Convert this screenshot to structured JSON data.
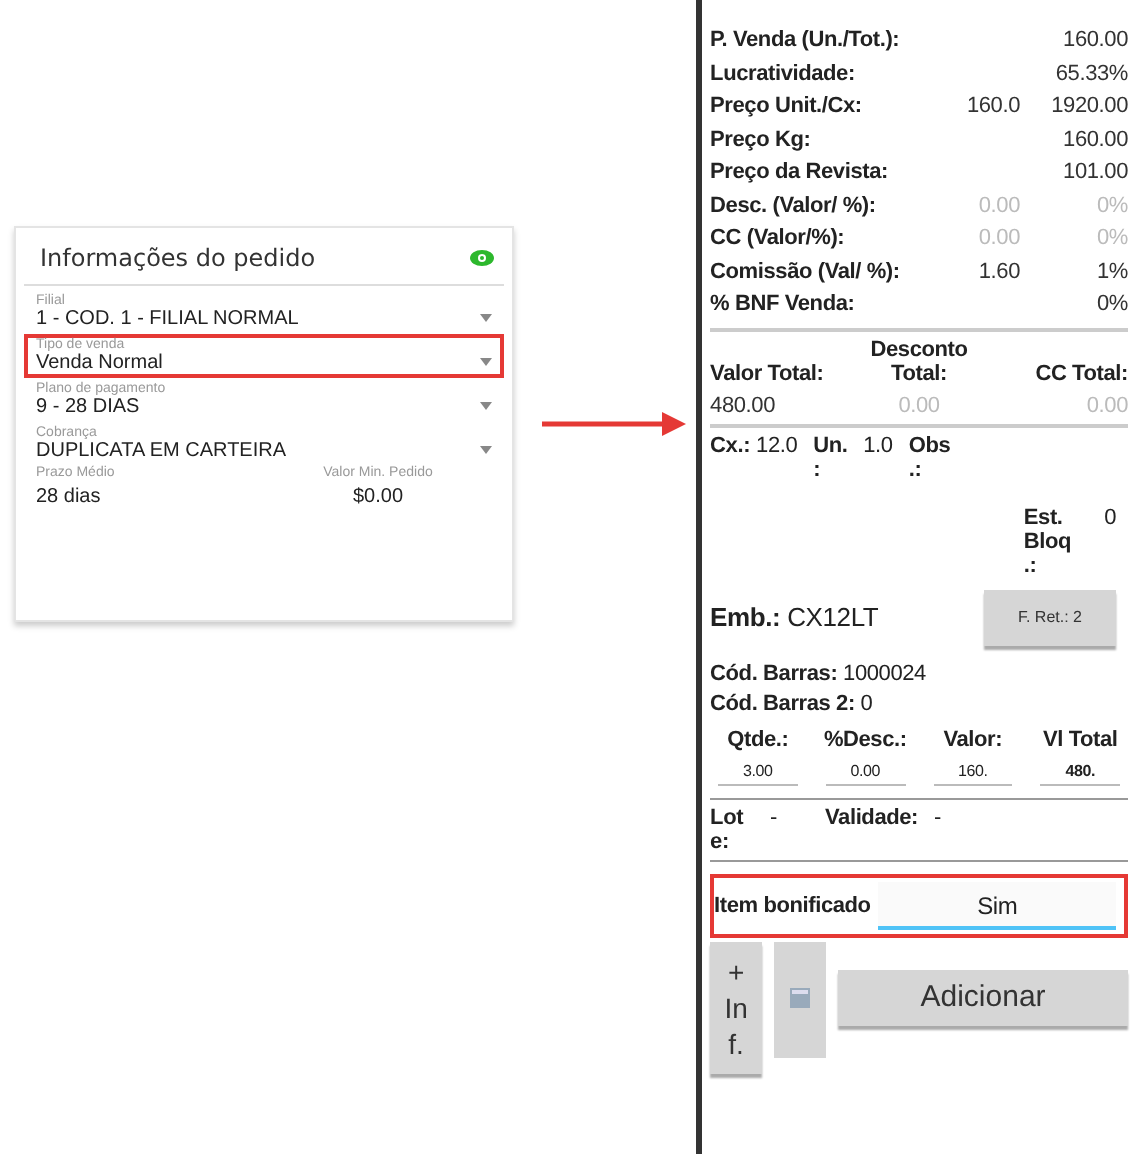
{
  "order_card": {
    "title": "Informações do pedido",
    "fields": [
      {
        "label": "Filial",
        "value": "1 - COD. 1 - FILIAL NORMAL",
        "highlighted": false
      },
      {
        "label": "Tipo de venda",
        "value": "Venda Normal",
        "highlighted": true
      },
      {
        "label": "Plano de pagamento",
        "value": "9 - 28 DIAS",
        "highlighted": false
      },
      {
        "label": "Cobrança",
        "value": "DUPLICATA EM CARTEIRA",
        "highlighted": false
      }
    ],
    "summary": [
      {
        "label": "Prazo Médio",
        "value": "28 dias"
      },
      {
        "label": "Valor Min. Pedido",
        "value": "$0.00"
      }
    ]
  },
  "item_panel": {
    "price_rows": [
      {
        "label": "P. Venda (Un./Tot.):",
        "value_1": "",
        "value_2": "160.00",
        "disabled": false
      },
      {
        "label": "Lucratividade:",
        "value_1": "",
        "value_2": "65.33%",
        "disabled": false
      },
      {
        "label": "Preço Unit./Cx:",
        "value_1": "160.0",
        "value_2": "1920.00",
        "disabled": false
      },
      {
        "label": "Preço Kg:",
        "value_1": "",
        "value_2": "160.00",
        "disabled": false
      },
      {
        "label": "Preço da Revista:",
        "value_1": "",
        "value_2": "101.00",
        "disabled": false
      },
      {
        "label": "Desc. (Valor/ %):",
        "value_1": "0.00",
        "value_2": "0%",
        "disabled": true
      },
      {
        "label": "CC (Valor/%):",
        "value_1": "0.00",
        "value_2": "0%",
        "disabled": true
      },
      {
        "label": "Comissão (Val/ %):",
        "value_1": "1.60",
        "value_2": "1%",
        "disabled": false
      },
      {
        "label": "% BNF Venda:",
        "value_1": "",
        "value_2": "0%",
        "disabled": false
      }
    ],
    "totals": [
      {
        "label": "Valor Total:",
        "value": "480.00",
        "disabled": false
      },
      {
        "label": "Desconto Total:",
        "value": "0.00",
        "disabled": true
      },
      {
        "label": "CC Total:",
        "value": "0.00",
        "disabled": true
      }
    ],
    "units": [
      {
        "label": "Cx.:",
        "value": "12.0"
      },
      {
        "label": "Un. :",
        "value": "1.0"
      },
      {
        "label": "Obs .:"
      }
    ],
    "blocked_stock": {
      "label": "Est. Bloq .:",
      "value": "0"
    },
    "packaging": {
      "label": "Emb.:",
      "value": "CX12LT"
    },
    "return_button": "F. Ret.: 2",
    "barcodes": [
      {
        "label": "Cód. Barras:",
        "value": "1000024"
      },
      {
        "label": "Cód. Barras 2:",
        "value": "0"
      }
    ],
    "quantity_columns": [
      {
        "label": "Qtde.:",
        "value": "3.00"
      },
      {
        "label": "%Desc.:",
        "value": "0.00"
      },
      {
        "label": "Valor:",
        "value": "160."
      },
      {
        "label": "Vl Total",
        "value": "480."
      }
    ],
    "lot": [
      {
        "label": "Lot e:",
        "value": "-"
      },
      {
        "label": "Validade:",
        "value": "-"
      }
    ],
    "bonus": {
      "label": "Item bonificado",
      "value": "Sim",
      "highlighted": true
    },
    "info_button": "+ In f.",
    "add_button": "Adicionar"
  }
}
